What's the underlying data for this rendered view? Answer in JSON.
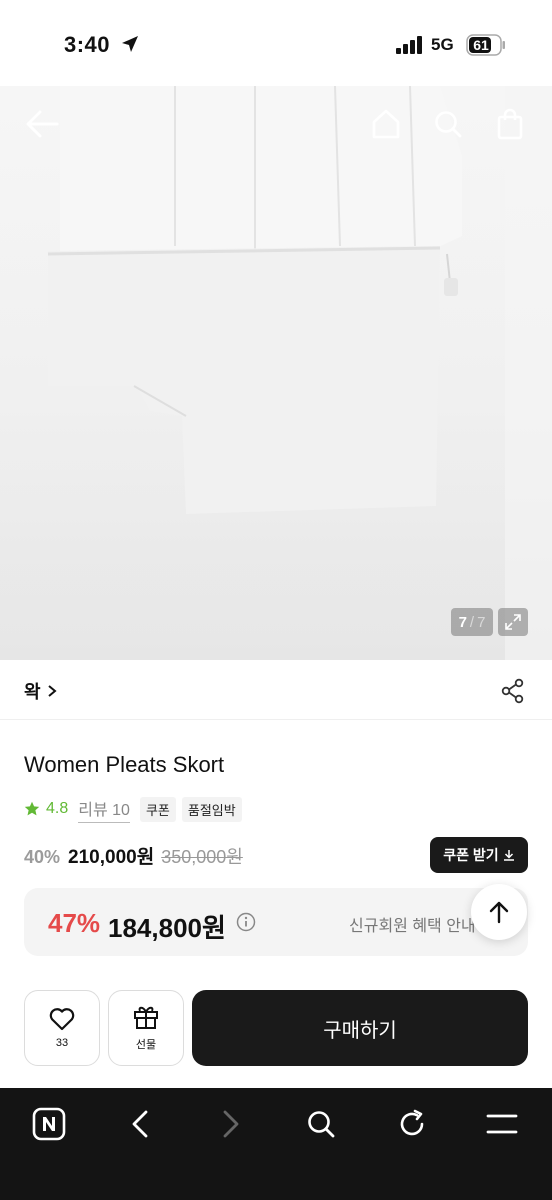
{
  "status_bar": {
    "time": "3:40",
    "network": "5G",
    "battery": "61"
  },
  "hero": {
    "image_index": "7",
    "image_separator": "/",
    "image_total": "7"
  },
  "brand": {
    "name": "왁"
  },
  "product": {
    "title": "Women Pleats Skort",
    "rating": "4.8",
    "review_label": "리뷰 10",
    "badges": [
      "쿠폰",
      "품절임박"
    ],
    "discount_rate": "40%",
    "sale_price": "210,000원",
    "original_price": "350,000원",
    "coupon_button": "쿠폰 받기"
  },
  "benefit": {
    "rate": "47%",
    "price": "184,800원",
    "link": "신규회원 혜택 안내"
  },
  "actions": {
    "like_count": "33",
    "gift_label": "선물",
    "buy_label": "구매하기"
  },
  "colors": {
    "accent_red": "#e54a4a",
    "rating_green": "#62b935",
    "dark": "#1a1a1a"
  },
  "icons": [
    "location-arrow-icon",
    "signal-icon",
    "battery-icon",
    "back-arrow-icon",
    "home-icon",
    "search-icon",
    "shopping-bag-icon",
    "expand-icon",
    "chevron-right-icon",
    "share-icon",
    "star-icon",
    "download-icon",
    "info-icon",
    "arrow-up-icon",
    "heart-icon",
    "gift-icon",
    "naver-icon",
    "browser-back-icon",
    "browser-forward-icon",
    "browser-search-icon",
    "refresh-icon",
    "menu-icon"
  ]
}
